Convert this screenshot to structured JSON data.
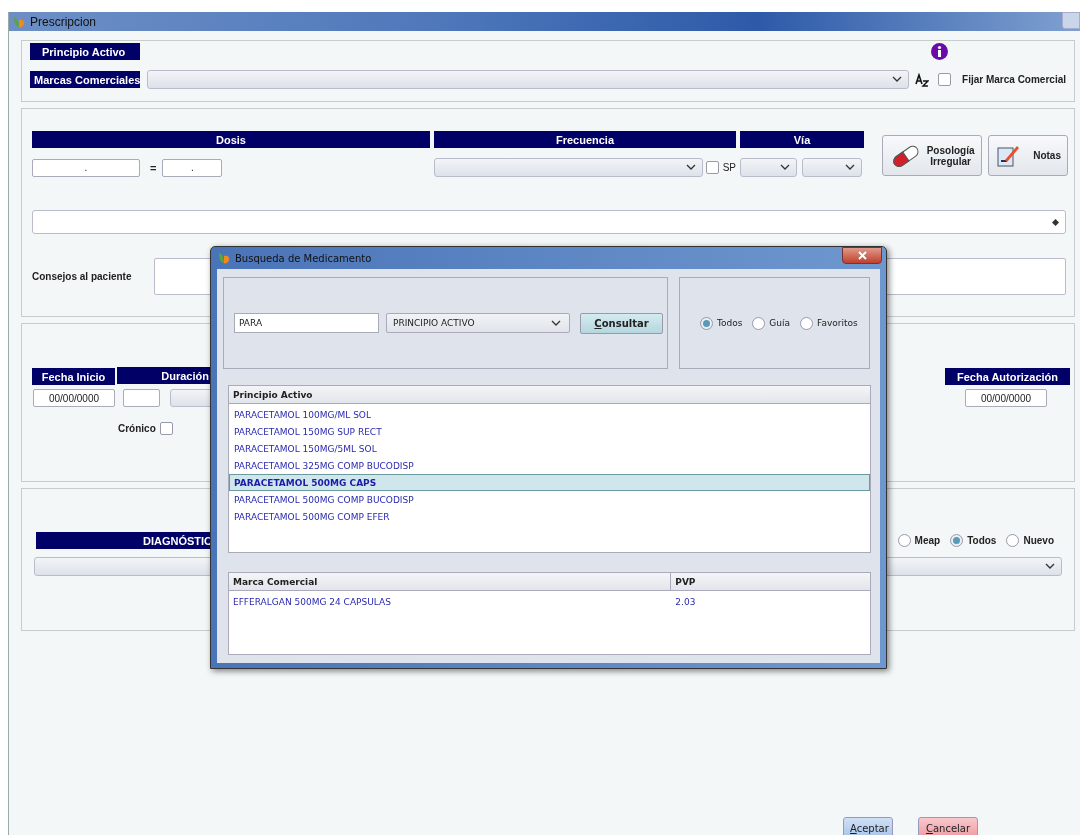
{
  "window": {
    "title": "Prescripcion"
  },
  "drug_panel": {
    "principio_activo_label": "Principio Activo",
    "marcas_label": "Marcas Comerciales",
    "fijar_marca": {
      "label": "Fijar Marca Comercial",
      "checked": false
    }
  },
  "dosage_panel": {
    "headers": [
      "Dosis",
      "Frecuencia",
      "Vía"
    ],
    "dose_value": ".",
    "dose_separator": "=",
    "dose_equiv_value": ".",
    "sp": {
      "label": "SP",
      "checked": false
    },
    "buttons": [
      {
        "label": "Posología Irregular",
        "kind": "pill"
      },
      {
        "label": "Notas",
        "kind": "notes"
      }
    ],
    "consejos_label": "Consejos al paciente"
  },
  "dates_panel": {
    "fecha_inicio": {
      "label": "Fecha Inicio",
      "value": "00/00/0000"
    },
    "duracion_label": "Duración",
    "cronico": {
      "label": "Crónico",
      "checked": false
    },
    "fecha_autorizacion": {
      "label": "Fecha Autorización",
      "value": "00/00/0000"
    }
  },
  "diagnosis_panel": {
    "header": "DIAGNÓSTIC",
    "filters": [
      {
        "label": "Meap",
        "selected": false
      },
      {
        "label": "Todos",
        "selected": true
      },
      {
        "label": "Nuevo",
        "selected": false
      }
    ]
  },
  "buttons": [
    {
      "label": "Aceptar",
      "kind": "accept"
    },
    {
      "label": "Cancelar",
      "kind": "cancel"
    }
  ],
  "dialog": {
    "title": "Busqueda de Medicamento",
    "search": {
      "value": "PARA"
    },
    "search_type": "PRINCIPIO ACTIVO",
    "consult_button": "Consultar",
    "filters": [
      {
        "label": "Todos",
        "selected": true
      },
      {
        "label": "Guía",
        "selected": false
      },
      {
        "label": "Favoritos",
        "selected": false
      }
    ],
    "principio_table": {
      "columns": [
        "Principio Activo"
      ],
      "rows": [
        {
          "name": "PARACETAMOL 100MG/ML SOL",
          "selected": false
        },
        {
          "name": "PARACETAMOL 150MG SUP RECT",
          "selected": false
        },
        {
          "name": "PARACETAMOL 150MG/5ML SOL",
          "selected": false
        },
        {
          "name": "PARACETAMOL 325MG COMP BUCODISP",
          "selected": false
        },
        {
          "name": "PARACETAMOL 500MG CAPS",
          "selected": true
        },
        {
          "name": "PARACETAMOL 500MG COMP BUCODISP",
          "selected": false
        },
        {
          "name": "PARACETAMOL 500MG COMP EFER",
          "selected": false
        }
      ]
    },
    "marca_table": {
      "columns": [
        "Marca Comercial",
        "PVP"
      ],
      "rows": [
        [
          "EFFERALGAN 500MG 24 CAPSULAS",
          "2.03"
        ]
      ]
    }
  }
}
